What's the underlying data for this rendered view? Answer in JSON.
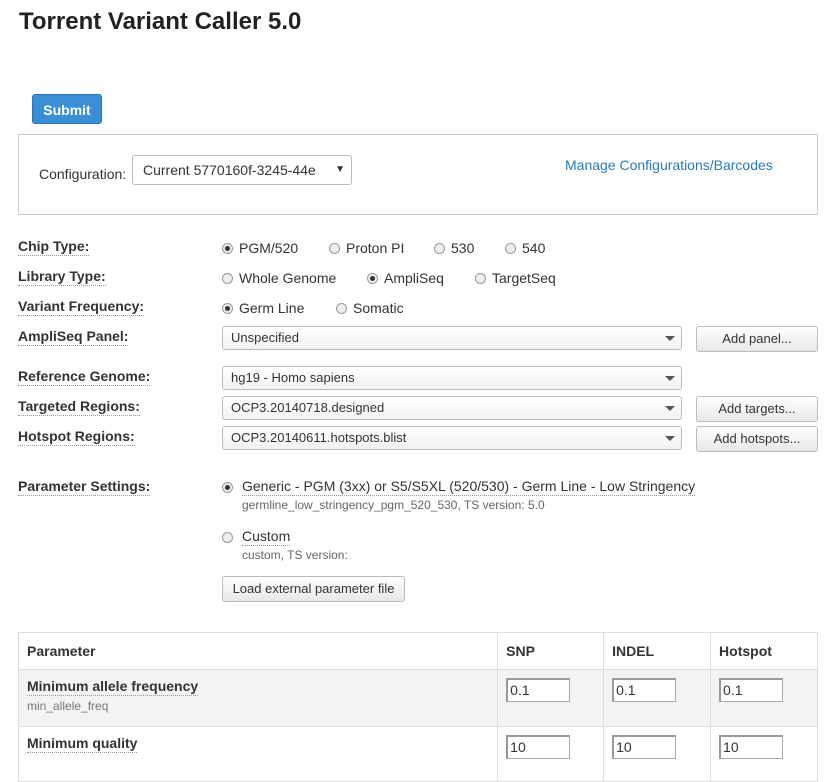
{
  "page": {
    "title": "Torrent Variant Caller 5.0"
  },
  "actions": {
    "submit_label": "Submit"
  },
  "config": {
    "label": "Configuration:",
    "selected": "Current 5770160f-3245-44e",
    "manage_link": "Manage Configurations/Barcodes"
  },
  "chip_type": {
    "label": "Chip Type:",
    "options": [
      "PGM/520",
      "Proton PI",
      "530",
      "540"
    ],
    "selected": "PGM/520"
  },
  "library_type": {
    "label": "Library Type:",
    "options": [
      "Whole Genome",
      "AmpliSeq",
      "TargetSeq"
    ],
    "selected": "AmpliSeq"
  },
  "variant_frequency": {
    "label": "Variant Frequency:",
    "options": [
      "Germ Line",
      "Somatic"
    ],
    "selected": "Germ Line"
  },
  "ampliseq_panel": {
    "label": "AmpliSeq Panel:",
    "value": "Unspecified",
    "button": "Add panel..."
  },
  "reference_genome": {
    "label": "Reference Genome:",
    "value": "hg19 - Homo sapiens"
  },
  "targeted_regions": {
    "label": "Targeted Regions:",
    "value": "OCP3.20140718.designed",
    "button": "Add targets..."
  },
  "hotspot_regions": {
    "label": "Hotspot Regions:",
    "value": "OCP3.20140611.hotspots.blist",
    "button": "Add hotspots..."
  },
  "parameter_settings": {
    "label": "Parameter Settings:",
    "options": [
      {
        "name": "Generic - PGM (3xx) or S5/S5XL (520/530) - Germ Line - Low Stringency",
        "sub": "germline_low_stringency_pgm_520_530, TS version: 5.0",
        "selected": true
      },
      {
        "name": "Custom",
        "sub": "custom, TS version:",
        "selected": false
      }
    ],
    "load_button": "Load external parameter file"
  },
  "params_table": {
    "headers": [
      "Parameter",
      "SNP",
      "INDEL",
      "Hotspot"
    ],
    "rows": [
      {
        "name": "Minimum allele frequency",
        "key": "min_allele_freq",
        "snp": "0.1",
        "indel": "0.1",
        "hotspot": "0.1"
      },
      {
        "name": "Minimum quality",
        "key": "",
        "snp": "10",
        "indel": "10",
        "hotspot": "10"
      }
    ]
  }
}
